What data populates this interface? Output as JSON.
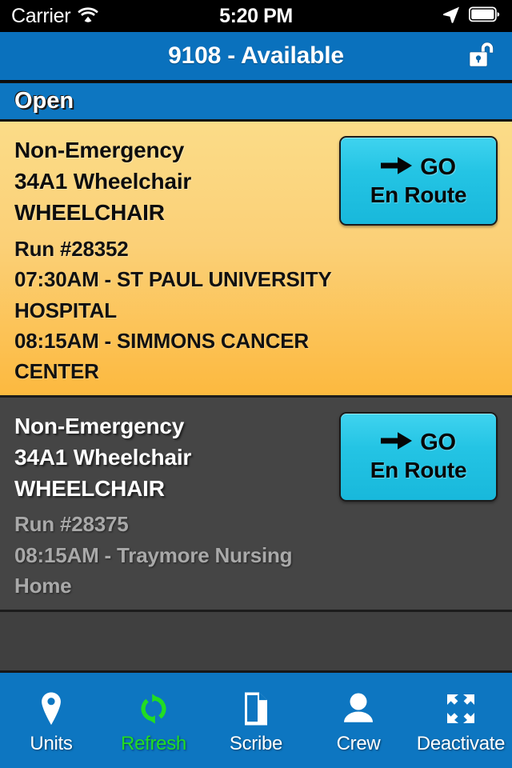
{
  "status_bar": {
    "carrier": "Carrier",
    "time": "5:20 PM",
    "wifi_icon": "wifi-icon",
    "location_icon": "location-arrow-icon",
    "battery_icon": "battery-full-icon"
  },
  "nav_bar": {
    "title": "9108 - Available",
    "lock_icon": "unlocked-padlock-icon"
  },
  "section": {
    "label": "Open"
  },
  "jobs": [
    {
      "state": "active",
      "priority": "Non-Emergency",
      "unit": "34A1 Wheelchair",
      "type": "WHEELCHAIR",
      "run": "Run #28352",
      "pickup": "07:30AM - ST PAUL UNIVERSITY HOSPITAL",
      "dropoff": "08:15AM - SIMMONS CANCER CENTER",
      "go_label": "GO",
      "go_sublabel": "En Route",
      "go_icon": "arrow-right-icon"
    },
    {
      "state": "inactive",
      "priority": "Non-Emergency",
      "unit": "34A1 Wheelchair",
      "type": "WHEELCHAIR",
      "run": "Run #28375",
      "pickup": "08:15AM - Traymore Nursing Home",
      "dropoff": "",
      "go_label": "GO",
      "go_sublabel": "En Route",
      "go_icon": "arrow-right-icon"
    }
  ],
  "tab_bar": {
    "items": [
      {
        "label": "Units",
        "icon": "map-pin-icon",
        "accent": false
      },
      {
        "label": "Refresh",
        "icon": "refresh-icon",
        "accent": true
      },
      {
        "label": "Scribe",
        "icon": "document-icon",
        "accent": false
      },
      {
        "label": "Crew",
        "icon": "person-icon",
        "accent": false
      },
      {
        "label": "Deactivate",
        "icon": "expand-arrows-icon",
        "accent": false
      }
    ]
  },
  "colors": {
    "brand_blue": "#0d76c1",
    "nav_blue": "#0a71bd",
    "active_card_yellow": "#fbd077",
    "inactive_card_gray": "#454545",
    "go_cyan": "#24c4e4",
    "refresh_green": "#22dd22"
  }
}
